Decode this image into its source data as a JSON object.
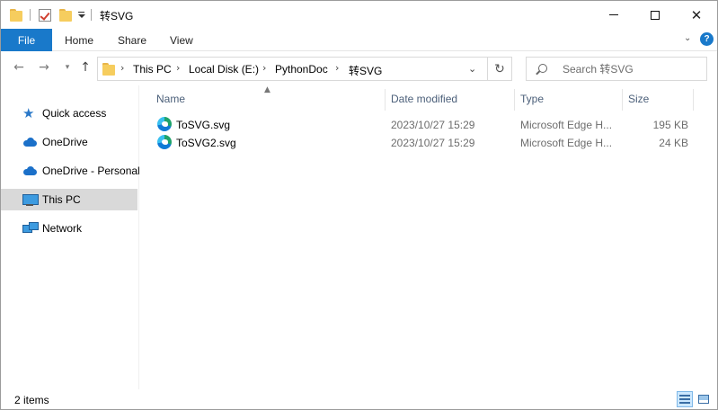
{
  "window": {
    "title": "转SVG",
    "controls": {
      "minimize": "—",
      "maximize": "☐",
      "close": "✕"
    }
  },
  "quick_access_toolbar": {
    "icons": [
      "folder-icon",
      "properties-check-icon",
      "new-folder-icon",
      "customize-dropdown-icon"
    ]
  },
  "ribbon": {
    "tabs": [
      "File",
      "Home",
      "Share",
      "View"
    ],
    "expand_icon": "chevron-down-icon",
    "help_label": "?"
  },
  "navigation": {
    "back_icon": "arrow-left-icon",
    "forward_icon": "arrow-right-icon",
    "recent_icon": "chevron-down-icon",
    "up_icon": "arrow-up-icon",
    "breadcrumb": [
      "This PC",
      "Local Disk (E:)",
      "PythonDoc",
      "转SVG"
    ],
    "refresh_icon": "refresh-icon",
    "search_placeholder": "Search 转SVG"
  },
  "nav_pane": {
    "items": [
      {
        "label": "Quick access",
        "icon": "star-icon",
        "selected": false
      },
      {
        "label": "OneDrive",
        "icon": "cloud-icon",
        "selected": false
      },
      {
        "label": "OneDrive - Personal",
        "icon": "cloud-icon",
        "selected": false
      },
      {
        "label": "This PC",
        "icon": "computer-icon",
        "selected": true
      },
      {
        "label": "Network",
        "icon": "network-icon",
        "selected": false
      }
    ]
  },
  "file_list": {
    "columns": [
      "Name",
      "Date modified",
      "Type",
      "Size"
    ],
    "sort_column": "Name",
    "rows": [
      {
        "name": "ToSVG.svg",
        "date": "2023/10/27 15:29",
        "type": "Microsoft Edge H...",
        "size": "195 KB",
        "icon": "edge-icon"
      },
      {
        "name": "ToSVG2.svg",
        "date": "2023/10/27 15:29",
        "type": "Microsoft Edge H...",
        "size": "24 KB",
        "icon": "edge-icon"
      }
    ]
  },
  "status_bar": {
    "item_count": "2 items",
    "view_modes": [
      "details-view-icon",
      "large-icons-view-icon"
    ],
    "active_view": "details-view-icon"
  },
  "colors": {
    "accent": "#1979ca",
    "selected_nav": "#d9d9d9",
    "column_header_text": "#4c607a",
    "secondary_text": "#6d6d6d"
  }
}
